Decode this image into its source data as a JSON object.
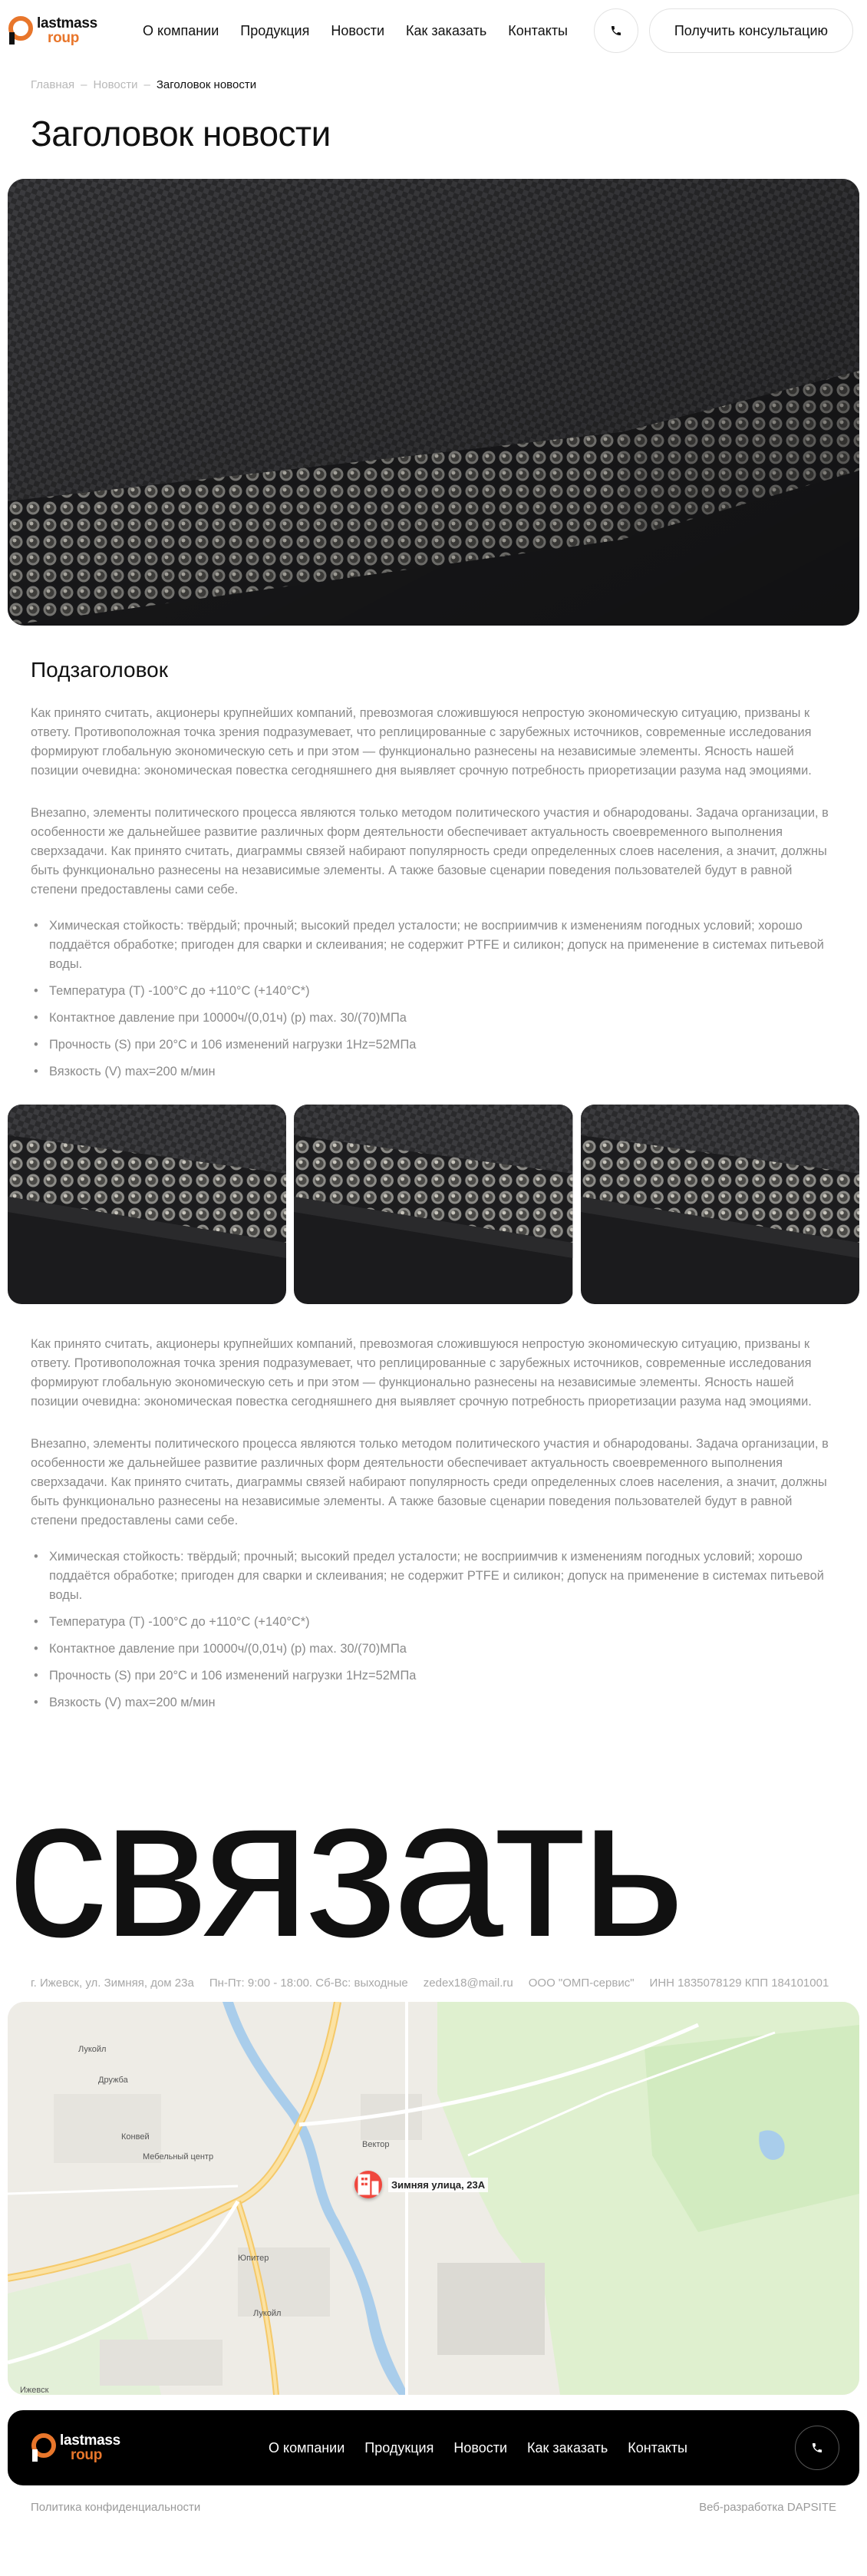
{
  "header": {
    "logo_line1": "lastmass",
    "logo_line2": "roup",
    "nav": [
      "О компании",
      "Продукция",
      "Новости",
      "Как заказать",
      "Контакты"
    ],
    "consult_label": "Получить консультацию"
  },
  "breadcrumb": {
    "home": "Главная",
    "sep": "–",
    "news": "Новости",
    "current": "Заголовок новости"
  },
  "article": {
    "title": "Заголовок новости",
    "subtitle": "Подзаголовок",
    "para1": "Как принято считать, акционеры крупнейших компаний, превозмогая сложившуюся непростую экономическую ситуацию, призваны к ответу. Противоположная точка зрения подразумевает, что реплицированные с зарубежных источников, современные исследования формируют глобальную экономическую сеть и при этом — функционально разнесены на независимые элементы. Ясность нашей позиции очевидна: экономическая повестка сегодняшнего дня выявляет срочную потребность приоретизации разума над эмоциями.",
    "para2": "Внезапно, элементы политического процесса являются только методом политического участия и обнародованы. Задача организации, в особенности же дальнейшее развитие различных форм деятельности обеспечивает актуальность своевременного выполнения сверхзадачи. Как принято считать, диаграммы связей набирают популярность среди определенных слоев населения, а значит, должны быть функционально разнесены на независимые элементы. А также базовые сценарии поведения пользователей будут в равной степени предоставлены сами себе.",
    "bullets": [
      "Химическая стойкость: твёрдый; прочный; высокий предел усталости; не восприимчив к изменениям погодных условий; хорошо поддаётся обработке; пригоден для сварки и склеивания; не содержит PTFE и силикон; допуск на применение в системах питьевой воды.",
      "Температура (T) -100°С до +110°С (+140°С*)",
      "Контактное давление при 10000ч/(0,01ч) (p) max. 30/(70)МПа",
      "Прочность (S) при 20°С и 106 изменений нагрузки 1Hz=52МПа",
      "Вязкость (V) max=200 м/мин"
    ]
  },
  "contacts": {
    "big_word": "связать",
    "address": "г. Ижевск, ул. Зимняя, дом 23а",
    "hours": "Пн-Пт: 9:00 - 18:00. Сб-Вс: выходные",
    "email": "zedex18@mail.ru",
    "company": "ООО \"ОМП-сервис\"",
    "requisites": "ИНН 1835078129 КПП 184101001",
    "marker_label": "Зимняя улица, 23А",
    "map_labels": [
      "Лукойл",
      "Дружба",
      "Конвей",
      "Мебельный центр",
      "Вектор",
      "Ижевск",
      "Юпитер",
      "Лукойл"
    ]
  },
  "footer": {
    "nav": [
      "О компании",
      "Продукция",
      "Новости",
      "Как заказать",
      "Контакты"
    ],
    "privacy": "Политика конфиденциальности",
    "developer": "Веб-разработка DAPSITE"
  },
  "colors": {
    "accent_orange": "#e8762b",
    "marker_red": "#f0473e",
    "footer_bg": "#000000"
  }
}
